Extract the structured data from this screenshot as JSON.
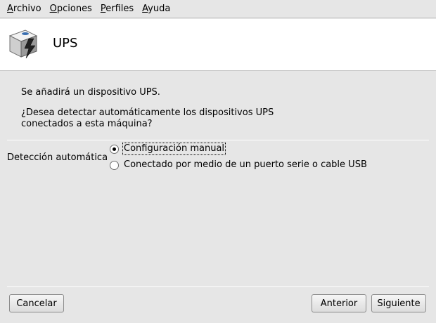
{
  "menubar": {
    "items": [
      {
        "mnemonic": "A",
        "rest": "rchivo"
      },
      {
        "mnemonic": "O",
        "rest": "pciones"
      },
      {
        "mnemonic": "P",
        "rest": "erfiles"
      },
      {
        "mnemonic": "A",
        "rest": "yuda"
      }
    ]
  },
  "header": {
    "title": "UPS",
    "icon": "ups-power-icon"
  },
  "main": {
    "message_1": "Se añadirá un dispositivo UPS.",
    "message_2_line_1": "¿Desea detectar automáticamente los dispositivos UPS",
    "message_2_line_2": "conectados a esta máquina?",
    "group_label": "Detección automática",
    "options": [
      {
        "label": "Configuración manual",
        "selected": true
      },
      {
        "label": "Conectado por medio de un puerto serie o cable USB",
        "selected": false
      }
    ]
  },
  "buttons": {
    "cancel": "Cancelar",
    "previous": "Anterior",
    "next": "Siguiente"
  }
}
